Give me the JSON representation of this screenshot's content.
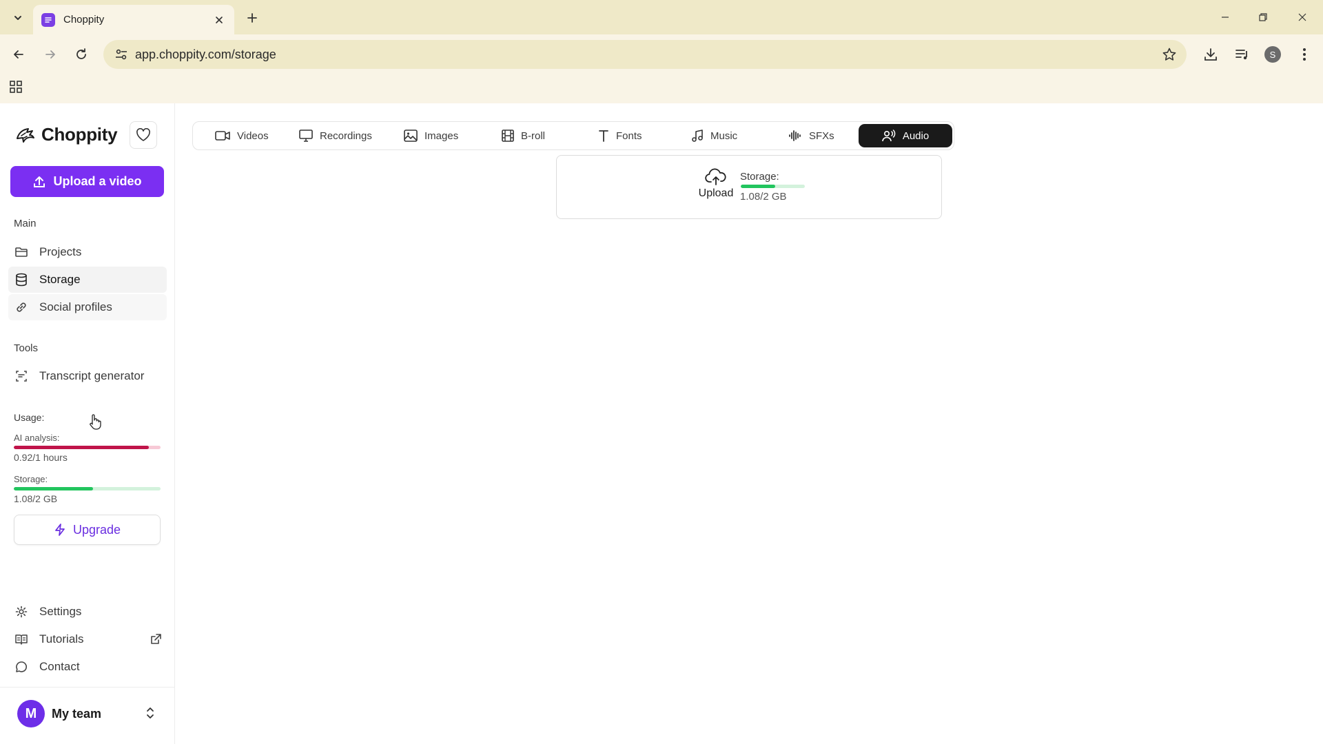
{
  "browser": {
    "tab_title": "Choppity",
    "url": "app.choppity.com/storage",
    "profile_initial": "S"
  },
  "sidebar": {
    "brand": "Choppity",
    "upload_label": "Upload a video",
    "main_section": "Main",
    "main_items": [
      {
        "label": "Projects",
        "icon": "folder-icon"
      },
      {
        "label": "Storage",
        "icon": "database-icon",
        "active": true
      },
      {
        "label": "Social profiles",
        "icon": "link-icon"
      }
    ],
    "tools_section": "Tools",
    "tools_items": [
      {
        "label": "Transcript generator",
        "icon": "transcript-icon"
      }
    ],
    "usage": {
      "title": "Usage:",
      "ai_label": "AI analysis:",
      "ai_value": "0.92/1 hours",
      "ai_fraction": 0.92,
      "storage_label": "Storage:",
      "storage_value": "1.08/2 GB",
      "storage_fraction": 0.54
    },
    "upgrade_label": "Upgrade",
    "bottom_items": [
      {
        "label": "Settings",
        "icon": "gear-icon"
      },
      {
        "label": "Tutorials",
        "icon": "book-icon",
        "external": true
      },
      {
        "label": "Contact",
        "icon": "chat-icon"
      }
    ],
    "team": {
      "initial": "M",
      "name": "My team"
    }
  },
  "main": {
    "tabs": [
      {
        "label": "Videos",
        "icon": "video-icon"
      },
      {
        "label": "Recordings",
        "icon": "monitor-icon"
      },
      {
        "label": "Images",
        "icon": "image-icon"
      },
      {
        "label": "B-roll",
        "icon": "film-icon"
      },
      {
        "label": "Fonts",
        "icon": "font-icon"
      },
      {
        "label": "Music",
        "icon": "music-icon"
      },
      {
        "label": "SFXs",
        "icon": "waveform-icon"
      },
      {
        "label": "Audio",
        "icon": "voice-icon",
        "active": true
      }
    ],
    "upload_card": {
      "upload_label": "Upload",
      "storage_label": "Storage:",
      "storage_value": "1.08/2 GB",
      "storage_fraction": 0.54
    }
  },
  "colors": {
    "brand_purple": "#7b2ff2",
    "ai_bar": "#c0144a",
    "ai_bar_track": "#f7c9d6",
    "storage_bar": "#22c55e",
    "storage_bar_track": "#d3f2dc",
    "active_tab": "#1a1a1a"
  }
}
